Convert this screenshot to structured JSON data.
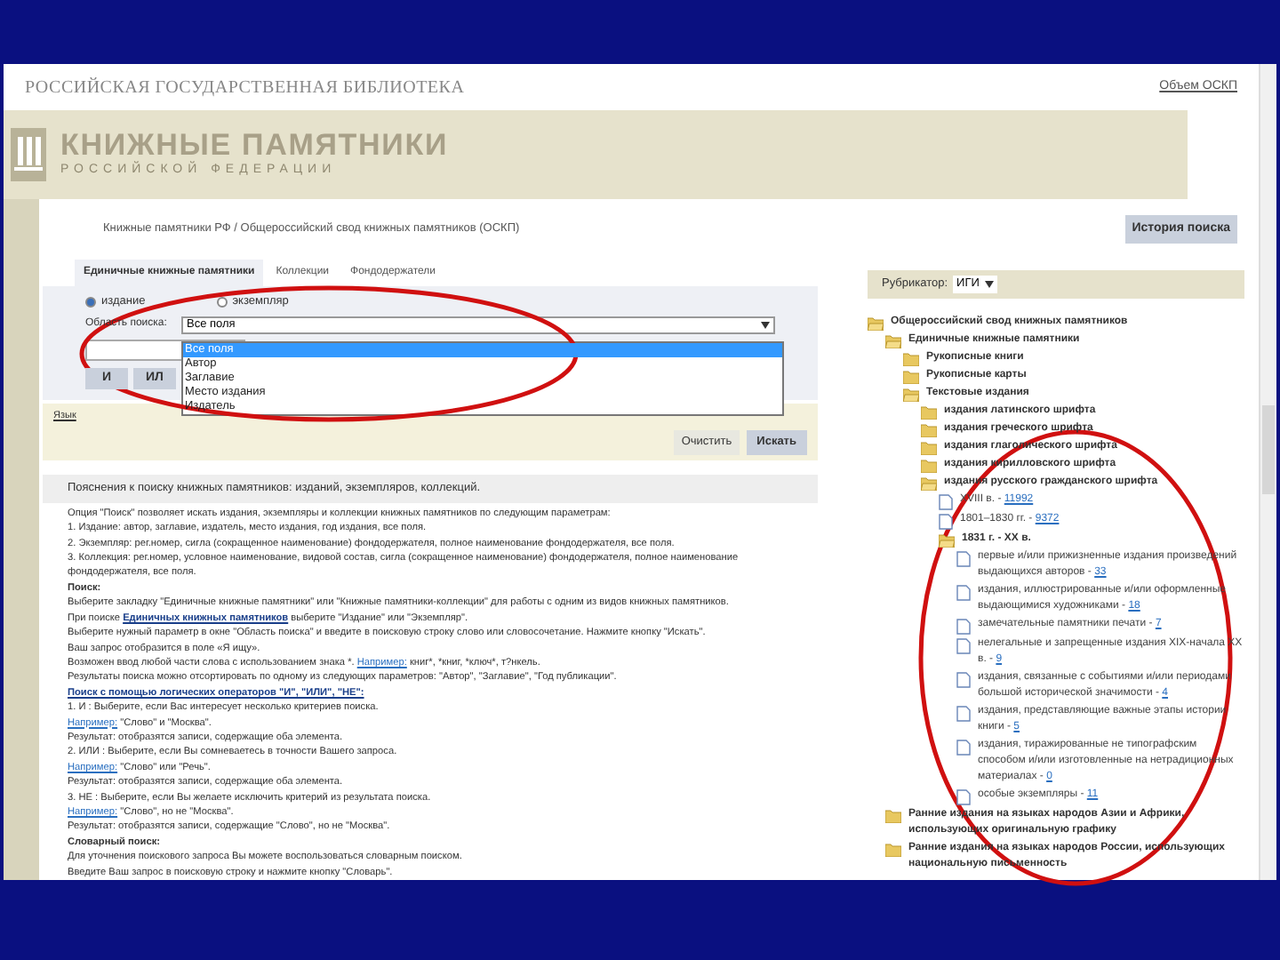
{
  "site_title": "РОССИЙСКАЯ ГОСУДАРСТВЕННАЯ БИБЛИОТЕКА",
  "volume_link": "Объем ОСКП",
  "logo": {
    "title": "КНИЖНЫЕ ПАМЯТНИКИ",
    "subtitle": "РОССИЙСКОЙ ФЕДЕРАЦИИ"
  },
  "breadcrumb": "Книжные памятники РФ / Общероссийский свод книжных памятников (ОСКП)",
  "history_button": "История поиска",
  "tabs": [
    {
      "label": "Единичные книжные памятники",
      "selected": true
    },
    {
      "label": "Коллекции",
      "selected": false
    },
    {
      "label": "Фондодержатели",
      "selected": false
    }
  ],
  "search": {
    "radios": [
      {
        "label": "издание",
        "selected": true
      },
      {
        "label": "экземпляр",
        "selected": false
      }
    ],
    "area_label": "Область поиска:",
    "area_value": "Все поля",
    "dropdown": [
      {
        "label": "Все поля",
        "selected": true
      },
      {
        "label": "Автор",
        "selected": false
      },
      {
        "label": "Заглавие",
        "selected": false
      },
      {
        "label": "Место издания",
        "selected": false
      },
      {
        "label": "Издатель",
        "selected": false
      }
    ],
    "operators": [
      "И",
      "ИЛ"
    ],
    "language_link": "Язык",
    "clear_button": "Очистить",
    "search_button": "Искать"
  },
  "help": {
    "title": "Пояснения к поиску книжных памятников: изданий, экземпляров, коллекций.",
    "lines": [
      [
        {
          "kind": "text",
          "text": "Опция \"Поиск\" позволяет искать издания, экземпляры и коллекции книжных памятников по следующим параметрам:"
        }
      ],
      [
        {
          "kind": "text",
          "text": "1. Издание: автор, заглавие, издатель, место издания, год издания, все поля."
        }
      ],
      [
        {
          "kind": "text",
          "text": "2. Экземпляр: рег.номер, сигла (сокращенное наименование) фондодержателя, полное наименование фондодержателя, все поля."
        }
      ],
      [
        {
          "kind": "text",
          "text": "3. Коллекция: рег.номер, условное наименование, видовой состав, сигла (сокращенное наименование) фондодержателя, полное наименование фондодержателя, все поля."
        }
      ],
      [
        {
          "kind": "bold",
          "text": "Поиск:"
        }
      ],
      [
        {
          "kind": "text",
          "text": "Выберите закладку \"Единичные книжные памятники\" или \"Книжные памятники-коллекции\" для работы с одним из видов книжных памятников."
        }
      ],
      [
        {
          "kind": "text",
          "text": "При поиске "
        },
        {
          "kind": "strong-link",
          "text": "Единичных книжных памятников"
        },
        {
          "kind": "text",
          "text": " выберите \"Издание\" или \"Экземпляр\"."
        }
      ],
      [
        {
          "kind": "text",
          "text": "Выберите нужный параметр в окне \"Область поиска\" и введите в поисковую строку слово или словосочетание. Нажмите кнопку \"Искать\"."
        }
      ],
      [
        {
          "kind": "text",
          "text": "Ваш запрос отобразится в поле «Я ищу»."
        }
      ],
      [
        {
          "kind": "text",
          "text": "Возможен ввод любой части слова с использованием знака *. "
        },
        {
          "kind": "link",
          "text": "Например:"
        },
        {
          "kind": "text",
          "text": " книг*, *книг, *ключ*, т?нкель."
        }
      ],
      [
        {
          "kind": "text",
          "text": "Результаты поиска можно отсортировать по одному из следующих параметров: \"Автор\", \"Заглавие\", \"Год публикации\"."
        }
      ],
      [
        {
          "kind": "strong-link",
          "text": "Поиск с помощью логических операторов \"И\", \"ИЛИ\", \"НЕ\":"
        }
      ],
      [
        {
          "kind": "text",
          "text": "1. И : Выберите, если Вас интересует несколько критериев поиска."
        }
      ],
      [
        {
          "kind": "link",
          "text": "Например:"
        },
        {
          "kind": "text",
          "text": " \"Слово\" и \"Москва\"."
        }
      ],
      [
        {
          "kind": "text",
          "text": "Результат: отобразятся записи, содержащие оба элемента."
        }
      ],
      [
        {
          "kind": "text",
          "text": "2. ИЛИ : Выберите, если Вы сомневаетесь в точности Вашего запроса."
        }
      ],
      [
        {
          "kind": "link",
          "text": "Например:"
        },
        {
          "kind": "text",
          "text": " \"Слово\" или \"Речь\"."
        }
      ],
      [
        {
          "kind": "text",
          "text": "Результат: отобразятся записи, содержащие оба элемента."
        }
      ],
      [
        {
          "kind": "text",
          "text": "3. НЕ : Выберите, если Вы желаете исключить критерий из результата поиска."
        }
      ],
      [
        {
          "kind": "link",
          "text": "Например:"
        },
        {
          "kind": "text",
          "text": " \"Слово\", но не \"Москва\"."
        }
      ],
      [
        {
          "kind": "text",
          "text": "Результат: отобразятся записи, содержащие \"Слово\", но не \"Москва\"."
        }
      ],
      [
        {
          "kind": "bold",
          "text": "Словарный поиск:"
        }
      ],
      [
        {
          "kind": "text",
          "text": "Для уточнения поискового запроса Вы можете воспользоваться словарным поиском."
        }
      ],
      [
        {
          "kind": "text",
          "text": "Введите Ваш запрос в поисковую строку и нажмите кнопку \"Словарь\"."
        }
      ]
    ]
  },
  "rubricator": {
    "label": "Рубрикатор:",
    "value": "ИГИ",
    "tree": [
      {
        "kind": "folder",
        "label": "Общероссийский свод книжных памятников",
        "expanded": true,
        "children": [
          {
            "kind": "folder",
            "label": "Единичные книжные памятники",
            "expanded": true,
            "children": [
              {
                "kind": "folder",
                "label": "Рукописные книги",
                "expanded": false
              },
              {
                "kind": "folder",
                "label": "Рукописные карты",
                "expanded": false
              },
              {
                "kind": "folder",
                "label": "Текстовые издания",
                "expanded": true,
                "children": [
                  {
                    "kind": "folder",
                    "label": "издания латинского шрифта",
                    "expanded": false
                  },
                  {
                    "kind": "folder",
                    "label": "издания греческого шрифта",
                    "expanded": false
                  },
                  {
                    "kind": "folder",
                    "label": "издания глаголического шрифта",
                    "expanded": false
                  },
                  {
                    "kind": "folder",
                    "label": "издания кирилловского шрифта",
                    "expanded": false
                  },
                  {
                    "kind": "folder",
                    "label": "издания русского гражданского шрифта",
                    "expanded": true,
                    "children": [
                      {
                        "kind": "doc",
                        "label": "XVIII в. -",
                        "count": "11992"
                      },
                      {
                        "kind": "doc",
                        "label": "1801–1830 гг. -",
                        "count": "9372"
                      },
                      {
                        "kind": "folder",
                        "label": "1831 г. - XX в.",
                        "expanded": true,
                        "children": [
                          {
                            "kind": "doc",
                            "label": "первые и/или прижизненные издания произведений выдающихся авторов -",
                            "count": "33"
                          },
                          {
                            "kind": "doc",
                            "label": "издания, иллюстрированные и/или оформленные выдающимися художниками -",
                            "count": "18"
                          },
                          {
                            "kind": "doc",
                            "label": "замечательные памятники печати -",
                            "count": "7"
                          },
                          {
                            "kind": "doc",
                            "label": "нелегальные и запрещенные издания XIX-начала XX в. -",
                            "count": "9"
                          },
                          {
                            "kind": "doc",
                            "label": "издания, связанные с событиями и/или периодами большой исторической значимости -",
                            "count": "4"
                          },
                          {
                            "kind": "doc",
                            "label": "издания, представляющие важные этапы истории книги -",
                            "count": "5"
                          },
                          {
                            "kind": "doc",
                            "label": "издания, тиражированные не типографским способом и/или изготовленные на нетрадиционных материалах -",
                            "count": "0"
                          },
                          {
                            "kind": "doc",
                            "label": "особые экземпляры -",
                            "count": "11"
                          }
                        ]
                      }
                    ]
                  }
                ]
              }
            ]
          },
          {
            "kind": "folder",
            "label": "Ранние издания на языках народов Азии и Африки, использующих оригинальную графику",
            "expanded": false
          },
          {
            "kind": "folder",
            "label": "Ранние издания на языках народов России, использующих национальную письменность",
            "expanded": false
          }
        ]
      }
    ]
  }
}
